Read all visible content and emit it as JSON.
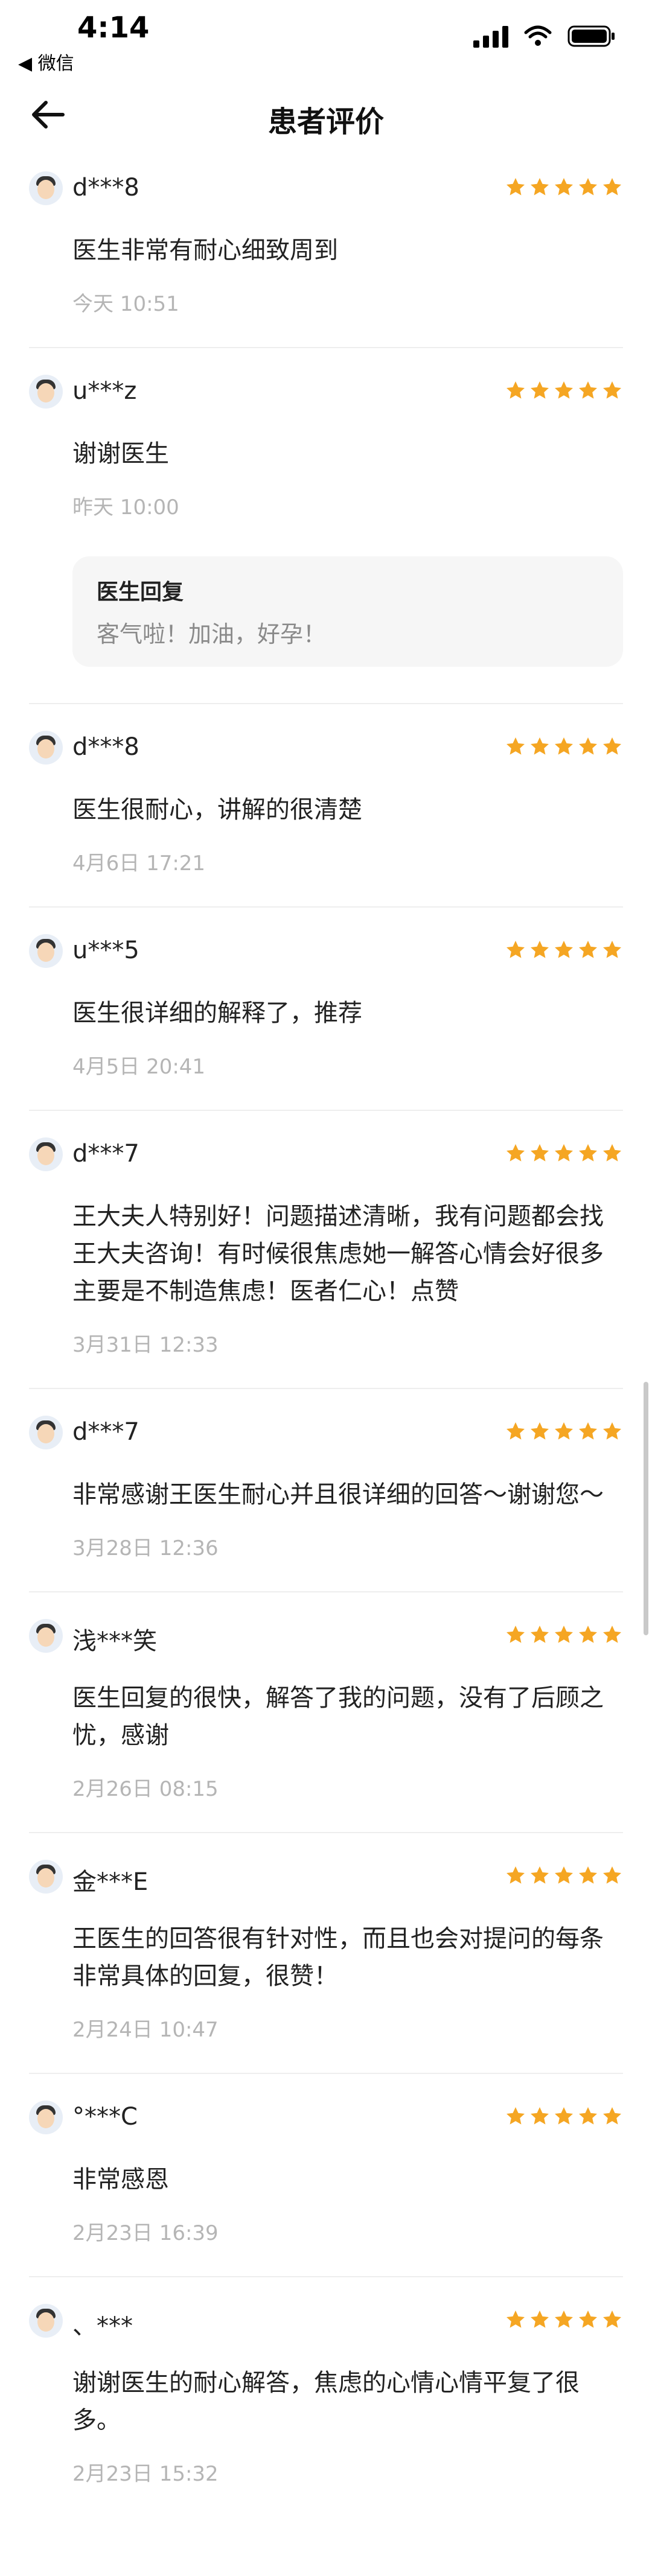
{
  "status": {
    "time": "4:14",
    "back_app": "◀ 微信"
  },
  "nav": {
    "title": "患者评价"
  },
  "colors": {
    "star": "#F5A623",
    "date": "#B5B5B5",
    "reply_bg": "#F6F6F6"
  },
  "reviews": [
    {
      "user": "d***8",
      "rating": 5,
      "comment": "医生非常有耐心细致周到",
      "date": "今天 10:51"
    },
    {
      "user": "u***z",
      "rating": 5,
      "comment": "谢谢医生",
      "date": "昨天 10:00",
      "reply_title": "医生回复",
      "reply_text": "客气啦！加油，好孕！"
    },
    {
      "user": "d***8",
      "rating": 5,
      "comment": "医生很耐心，讲解的很清楚",
      "date": "4月6日 17:21"
    },
    {
      "user": "u***5",
      "rating": 5,
      "comment": "医生很详细的解释了，推荐",
      "date": "4月5日 20:41"
    },
    {
      "user": "d***7",
      "rating": 5,
      "comment": "王大夫人特别好！问题描述清晰，我有问题都会找王大夫咨询！有时候很焦虑她一解答心情会好很多主要是不制造焦虑！医者仁心！点赞",
      "date": "3月31日 12:33"
    },
    {
      "user": "d***7",
      "rating": 5,
      "comment": "非常感谢王医生耐心并且很详细的回答～谢谢您～",
      "date": "3月28日 12:36"
    },
    {
      "user": "浅***笑",
      "rating": 5,
      "comment": "医生回复的很快，解答了我的问题，没有了后顾之忧，感谢",
      "date": "2月26日 08:15"
    },
    {
      "user": "金***E",
      "rating": 5,
      "comment": "王医生的回答很有针对性，而且也会对提问的每条非常具体的回复，很赞！",
      "date": "2月24日 10:47"
    },
    {
      "user": "°***C",
      "rating": 5,
      "comment": "非常感恩",
      "date": "2月23日 16:39"
    },
    {
      "user": "、***",
      "rating": 5,
      "comment": "谢谢医生的耐心解答，焦虑的心情心情平复了很多。",
      "date": "2月23日 15:32"
    }
  ]
}
